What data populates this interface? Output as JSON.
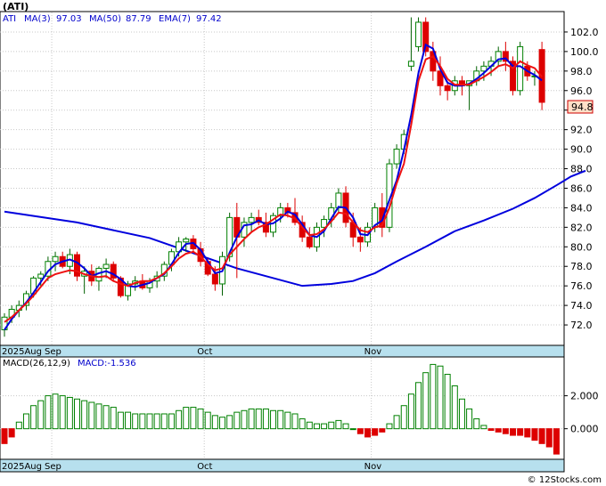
{
  "chart_data": [
    {
      "type": "candlestick",
      "title": "(ATI)",
      "legend": [
        {
          "label": "ATI",
          "color": "#0000cc"
        },
        {
          "label": "MA(3)",
          "color": "#0000cc"
        },
        {
          "label": "97.03",
          "color": "#0000cc"
        },
        {
          "label": "MA(50)",
          "color": "#0000cc"
        },
        {
          "label": "87.79",
          "color": "#0000cc"
        },
        {
          "label": "EMA(7)",
          "color": "#0000cc"
        },
        {
          "label": "97.42",
          "color": "#0000cc"
        }
      ],
      "price_axis": {
        "min": 70,
        "max": 104,
        "ticks": [
          "72.0",
          "74.0",
          "76.0",
          "78.0",
          "80.0",
          "82.0",
          "84.0",
          "86.0",
          "88.0",
          "90.0",
          "92.0",
          "94.0",
          "96.0",
          "98.0",
          "100.0",
          "102.0"
        ]
      },
      "last_price_label": "94.8",
      "x_labels": [
        {
          "label": "2025Aug",
          "index": 0
        },
        {
          "label": "Sep",
          "index": 7
        },
        {
          "label": "Oct",
          "index": 28
        },
        {
          "label": "Nov",
          "index": 51
        }
      ],
      "candles": [
        {
          "o": 71.5,
          "h": 73.2,
          "l": 70.8,
          "c": 72.8
        },
        {
          "o": 72.8,
          "h": 74.0,
          "l": 72.2,
          "c": 73.6
        },
        {
          "o": 73.5,
          "h": 74.5,
          "l": 72.8,
          "c": 74.0
        },
        {
          "o": 74.0,
          "h": 75.5,
          "l": 73.5,
          "c": 75.2
        },
        {
          "o": 75.2,
          "h": 77.0,
          "l": 74.8,
          "c": 76.8
        },
        {
          "o": 76.8,
          "h": 77.5,
          "l": 76.0,
          "c": 77.2
        },
        {
          "o": 77.0,
          "h": 79.0,
          "l": 76.5,
          "c": 78.5
        },
        {
          "o": 78.5,
          "h": 79.5,
          "l": 77.5,
          "c": 79.0
        },
        {
          "o": 79.0,
          "h": 79.5,
          "l": 77.8,
          "c": 78.0
        },
        {
          "o": 78.0,
          "h": 79.8,
          "l": 77.2,
          "c": 79.2
        },
        {
          "o": 79.2,
          "h": 79.5,
          "l": 76.5,
          "c": 77.0
        },
        {
          "o": 77.0,
          "h": 78.0,
          "l": 75.2,
          "c": 77.5
        },
        {
          "o": 77.5,
          "h": 78.2,
          "l": 76.0,
          "c": 76.5
        },
        {
          "o": 76.5,
          "h": 78.0,
          "l": 75.5,
          "c": 77.8
        },
        {
          "o": 77.8,
          "h": 78.8,
          "l": 76.8,
          "c": 78.2
        },
        {
          "o": 78.2,
          "h": 78.5,
          "l": 76.5,
          "c": 76.8
        },
        {
          "o": 76.8,
          "h": 77.0,
          "l": 74.8,
          "c": 75.0
        },
        {
          "o": 75.0,
          "h": 76.5,
          "l": 74.5,
          "c": 76.2
        },
        {
          "o": 76.2,
          "h": 77.0,
          "l": 75.5,
          "c": 76.5
        },
        {
          "o": 76.5,
          "h": 77.2,
          "l": 75.6,
          "c": 75.8
        },
        {
          "o": 75.8,
          "h": 76.8,
          "l": 75.3,
          "c": 76.5
        },
        {
          "o": 76.5,
          "h": 77.5,
          "l": 75.8,
          "c": 77.0
        },
        {
          "o": 77.0,
          "h": 78.5,
          "l": 76.5,
          "c": 78.2
        },
        {
          "o": 78.2,
          "h": 79.8,
          "l": 77.5,
          "c": 79.5
        },
        {
          "o": 79.5,
          "h": 81.0,
          "l": 79.0,
          "c": 80.5
        },
        {
          "o": 80.5,
          "h": 81.0,
          "l": 79.5,
          "c": 80.8
        },
        {
          "o": 80.8,
          "h": 81.2,
          "l": 79.5,
          "c": 79.8
        },
        {
          "o": 79.8,
          "h": 80.5,
          "l": 78.0,
          "c": 78.5
        },
        {
          "o": 78.5,
          "h": 78.8,
          "l": 77.0,
          "c": 77.2
        },
        {
          "o": 77.2,
          "h": 78.0,
          "l": 75.5,
          "c": 76.2
        },
        {
          "o": 76.2,
          "h": 79.5,
          "l": 75.0,
          "c": 79.0
        },
        {
          "o": 79.0,
          "h": 83.5,
          "l": 78.5,
          "c": 83.0
        },
        {
          "o": 83.0,
          "h": 84.5,
          "l": 76.8,
          "c": 81.0
        },
        {
          "o": 81.0,
          "h": 83.0,
          "l": 80.0,
          "c": 82.5
        },
        {
          "o": 82.5,
          "h": 83.5,
          "l": 81.5,
          "c": 83.0
        },
        {
          "o": 83.0,
          "h": 83.8,
          "l": 82.2,
          "c": 82.5
        },
        {
          "o": 82.5,
          "h": 83.5,
          "l": 81.0,
          "c": 81.5
        },
        {
          "o": 81.5,
          "h": 83.5,
          "l": 81.0,
          "c": 83.2
        },
        {
          "o": 83.2,
          "h": 84.5,
          "l": 82.5,
          "c": 84.0
        },
        {
          "o": 84.0,
          "h": 84.5,
          "l": 83.0,
          "c": 83.5
        },
        {
          "o": 83.5,
          "h": 85.0,
          "l": 82.2,
          "c": 82.5
        },
        {
          "o": 82.5,
          "h": 83.2,
          "l": 80.5,
          "c": 81.0
        },
        {
          "o": 81.0,
          "h": 82.0,
          "l": 79.8,
          "c": 80.0
        },
        {
          "o": 80.0,
          "h": 82.5,
          "l": 79.5,
          "c": 82.0
        },
        {
          "o": 82.0,
          "h": 83.2,
          "l": 81.0,
          "c": 82.8
        },
        {
          "o": 82.8,
          "h": 84.5,
          "l": 82.0,
          "c": 84.0
        },
        {
          "o": 84.0,
          "h": 86.0,
          "l": 83.5,
          "c": 85.5
        },
        {
          "o": 85.5,
          "h": 86.2,
          "l": 82.0,
          "c": 82.5
        },
        {
          "o": 82.5,
          "h": 83.5,
          "l": 80.0,
          "c": 81.0
        },
        {
          "o": 81.0,
          "h": 82.0,
          "l": 79.5,
          "c": 80.5
        },
        {
          "o": 80.5,
          "h": 82.5,
          "l": 80.0,
          "c": 82.0
        },
        {
          "o": 82.0,
          "h": 84.5,
          "l": 81.5,
          "c": 84.0
        },
        {
          "o": 84.0,
          "h": 85.5,
          "l": 81.0,
          "c": 82.0
        },
        {
          "o": 82.0,
          "h": 89.0,
          "l": 81.5,
          "c": 88.5
        },
        {
          "o": 88.5,
          "h": 90.5,
          "l": 88.0,
          "c": 90.0
        },
        {
          "o": 90.0,
          "h": 92.0,
          "l": 89.5,
          "c": 91.5
        },
        {
          "o": 98.5,
          "h": 103.5,
          "l": 98.0,
          "c": 99.0
        },
        {
          "o": 100.5,
          "h": 103.5,
          "l": 100.0,
          "c": 103.0
        },
        {
          "o": 103.0,
          "h": 103.5,
          "l": 99.5,
          "c": 100.0
        },
        {
          "o": 100.0,
          "h": 101.0,
          "l": 97.0,
          "c": 98.0
        },
        {
          "o": 98.0,
          "h": 99.5,
          "l": 95.5,
          "c": 96.5
        },
        {
          "o": 96.5,
          "h": 97.0,
          "l": 95.0,
          "c": 96.0
        },
        {
          "o": 96.0,
          "h": 97.5,
          "l": 95.5,
          "c": 97.0
        },
        {
          "o": 97.0,
          "h": 97.5,
          "l": 95.5,
          "c": 96.5
        },
        {
          "o": 96.5,
          "h": 97.0,
          "l": 94.0,
          "c": 97.0
        },
        {
          "o": 97.0,
          "h": 98.5,
          "l": 96.5,
          "c": 98.0
        },
        {
          "o": 98.0,
          "h": 99.0,
          "l": 97.0,
          "c": 98.5
        },
        {
          "o": 98.5,
          "h": 99.5,
          "l": 97.5,
          "c": 99.0
        },
        {
          "o": 99.0,
          "h": 100.5,
          "l": 98.5,
          "c": 100.0
        },
        {
          "o": 100.0,
          "h": 101.0,
          "l": 98.0,
          "c": 99.0
        },
        {
          "o": 99.0,
          "h": 99.5,
          "l": 95.5,
          "c": 96.0
        },
        {
          "o": 96.0,
          "h": 101.0,
          "l": 95.5,
          "c": 100.5
        },
        {
          "o": 98.5,
          "h": 99.0,
          "l": 97.0,
          "c": 97.5
        },
        {
          "o": 97.5,
          "h": 98.0,
          "l": 96.5,
          "c": 97.5
        },
        {
          "o": 100.2,
          "h": 101.0,
          "l": 94.0,
          "c": 94.8
        }
      ],
      "ema7": [
        72.3,
        72.8,
        73.5,
        74.2,
        75.0,
        75.9,
        76.8,
        77.2,
        77.4,
        77.6,
        77.5,
        77.2,
        77.0,
        76.9,
        77.0,
        76.5,
        76.2,
        76.0,
        76.3,
        76.5,
        76.5,
        76.8,
        77.3,
        78.0,
        78.8,
        79.3,
        79.5,
        79.0,
        78.2,
        77.6,
        77.8,
        79.2,
        80.0,
        80.8,
        81.5,
        82.0,
        82.3,
        82.8,
        83.3,
        83.2,
        82.9,
        82.0,
        81.2,
        81.3,
        81.8,
        82.6,
        83.5,
        83.4,
        82.5,
        81.7,
        81.5,
        82.0,
        82.2,
        84.0,
        86.5,
        88.5,
        92.5,
        97.0,
        99.2,
        99.5,
        98.5,
        97.2,
        96.6,
        96.6,
        96.6,
        97.0,
        97.4,
        97.9,
        98.5,
        98.7,
        98.3,
        99.0,
        98.6,
        98.3,
        97.42
      ],
      "ma3": [
        71.5,
        72.6,
        73.5,
        74.3,
        75.3,
        76.4,
        77.5,
        78.2,
        78.5,
        78.7,
        78.4,
        77.8,
        77.0,
        77.3,
        77.5,
        77.2,
        76.7,
        76.0,
        75.9,
        76.1,
        76.3,
        76.8,
        77.2,
        78.2,
        79.4,
        80.3,
        80.4,
        79.7,
        78.5,
        77.3,
        77.5,
        79.4,
        81.0,
        82.2,
        82.3,
        82.7,
        82.3,
        82.4,
        82.9,
        83.6,
        83.3,
        82.3,
        81.2,
        81.0,
        81.6,
        82.9,
        84.1,
        84.0,
        83.0,
        81.3,
        81.2,
        82.2,
        82.7,
        84.8,
        86.8,
        89.9,
        93.5,
        97.8,
        100.7,
        100.3,
        98.2,
        96.8,
        96.5,
        96.5,
        96.7,
        97.2,
        97.8,
        98.5,
        99.2,
        99.3,
        98.5,
        98.5,
        98.0,
        97.6,
        97.03
      ],
      "ma50": [
        [
          0,
          83.6
        ],
        [
          10,
          82.5
        ],
        [
          20,
          80.9
        ],
        [
          32,
          77.8
        ],
        [
          41,
          76.0
        ],
        [
          45,
          76.2
        ],
        [
          48,
          76.5
        ],
        [
          51,
          77.3
        ],
        [
          54,
          78.5
        ],
        [
          58,
          80.0
        ],
        [
          62,
          81.6
        ],
        [
          66,
          82.7
        ],
        [
          70,
          83.9
        ],
        [
          73,
          85.0
        ],
        [
          76,
          86.3
        ],
        [
          78,
          87.2
        ],
        [
          80,
          87.79
        ]
      ],
      "macd_label": "MACD(26,12,9)",
      "macd_value_label": "MACD:-1.536",
      "macd_axis": {
        "min": -1.8,
        "max": 4.3,
        "ticks": [
          "2.000",
          "0.000"
        ]
      },
      "macd": [
        -0.9,
        -0.5,
        0.4,
        0.9,
        1.4,
        1.7,
        2.0,
        2.1,
        2.0,
        1.9,
        1.8,
        1.7,
        1.6,
        1.5,
        1.4,
        1.3,
        1.0,
        1.0,
        0.9,
        0.9,
        0.9,
        0.9,
        0.9,
        0.9,
        1.1,
        1.3,
        1.3,
        1.2,
        1.0,
        0.8,
        0.7,
        0.8,
        1.0,
        1.1,
        1.2,
        1.2,
        1.2,
        1.1,
        1.1,
        1.0,
        0.9,
        0.6,
        0.4,
        0.3,
        0.3,
        0.4,
        0.5,
        0.3,
        0.0,
        -0.3,
        -0.5,
        -0.4,
        -0.2,
        0.3,
        0.8,
        1.4,
        2.1,
        2.8,
        3.4,
        3.9,
        3.8,
        3.3,
        2.6,
        1.8,
        1.2,
        0.6,
        0.2,
        -0.1,
        -0.2,
        -0.3,
        -0.4,
        -0.4,
        -0.5,
        -0.7,
        -0.9,
        -1.1,
        -1.536
      ]
    }
  ],
  "footer": {
    "watermark": "© 12Stocks.com"
  }
}
